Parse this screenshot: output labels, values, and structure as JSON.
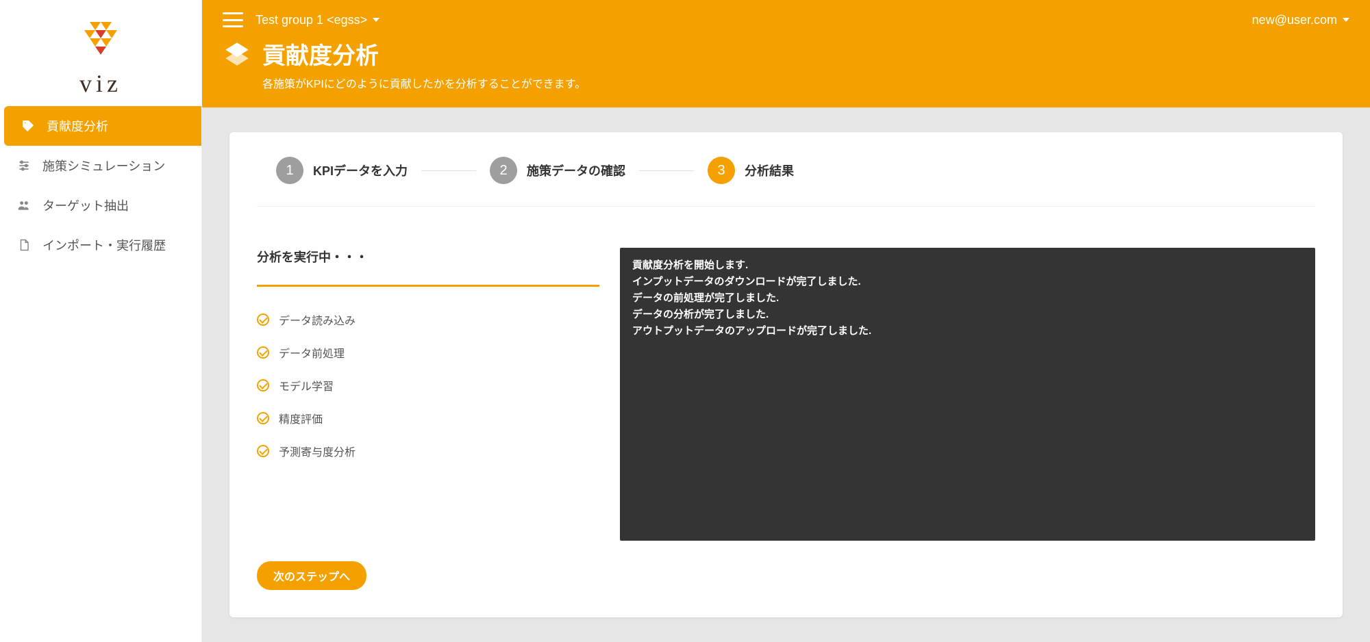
{
  "brand": {
    "name": "viz"
  },
  "sidebar": {
    "items": [
      {
        "label": "貢献度分析"
      },
      {
        "label": "施策シミュレーション"
      },
      {
        "label": "ターゲット抽出"
      },
      {
        "label": "インポート・実行履歴"
      }
    ]
  },
  "header": {
    "group": "Test group 1 <egss>",
    "user": "new@user.com",
    "title": "貢献度分析",
    "subtitle": "各施策がKPIにどのように貢献したかを分析することができます。"
  },
  "stepper": {
    "steps": [
      {
        "num": "1",
        "label": "KPIデータを入力"
      },
      {
        "num": "2",
        "label": "施策データの確認"
      },
      {
        "num": "3",
        "label": "分析結果"
      }
    ],
    "activeIndex": 2
  },
  "progress": {
    "title": "分析を実行中・・・",
    "steps": [
      "データ読み込み",
      "データ前処理",
      "モデル学習",
      "精度評価",
      "予測寄与度分析"
    ]
  },
  "console": {
    "lines": [
      "貢献度分析を開始します.",
      "インプットデータのダウンロードが完了しました.",
      "データの前処理が完了しました.",
      "データの分析が完了しました.",
      "アウトプットデータのアップロードが完了しました."
    ]
  },
  "buttons": {
    "next": "次のステップへ"
  }
}
